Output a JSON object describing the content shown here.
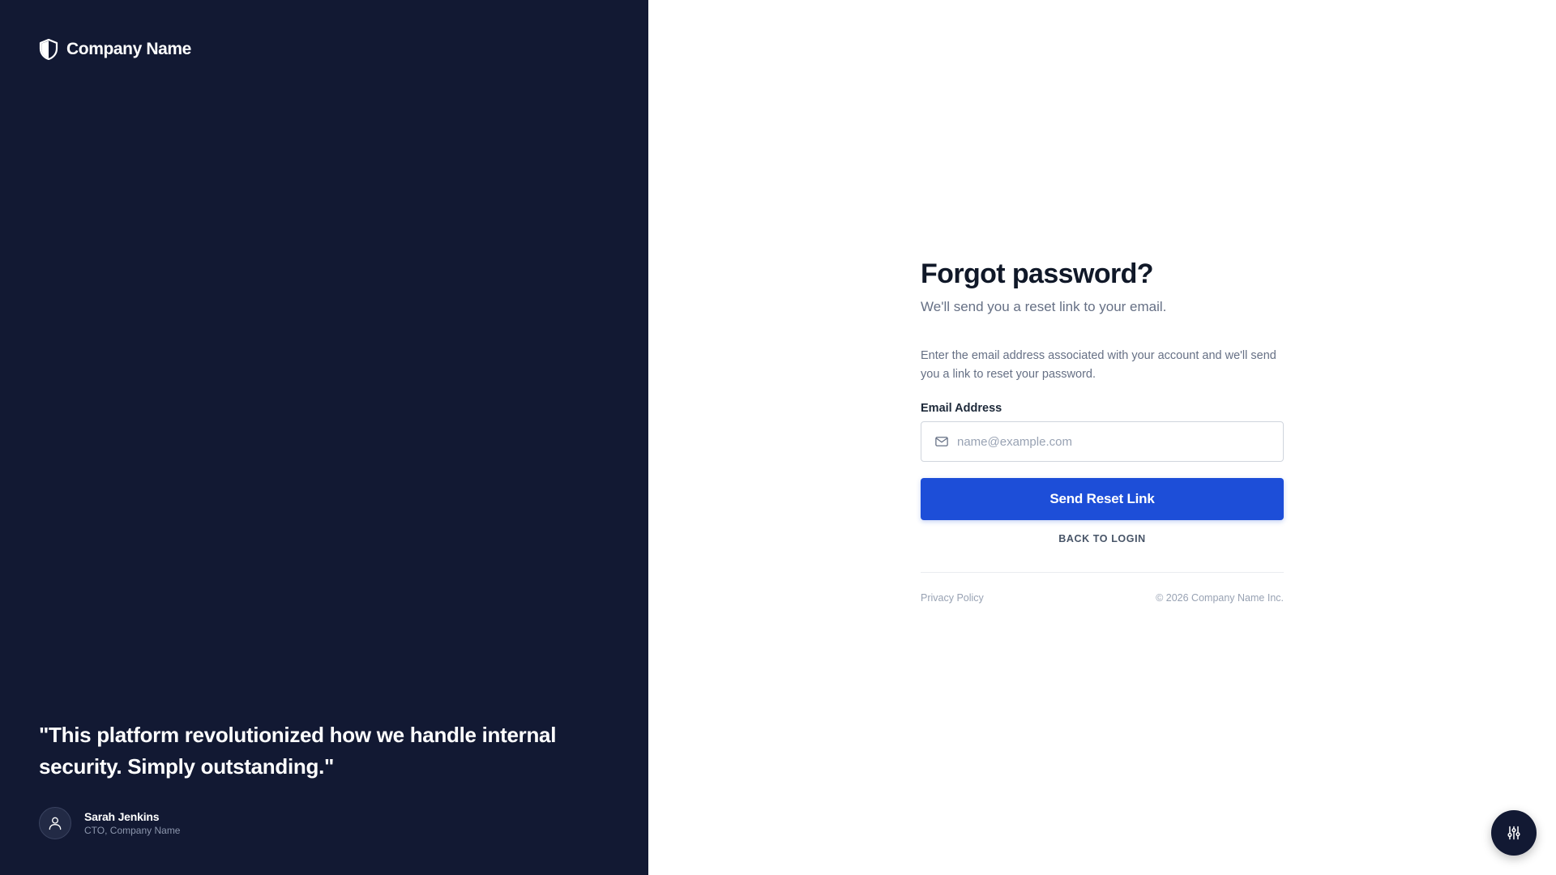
{
  "brand": {
    "name": "Company Name",
    "icon": "shield-icon"
  },
  "testimonial": {
    "quote": "\"This platform revolutionized how we handle internal security. Simply outstanding.\"",
    "author_name": "Sarah Jenkins",
    "author_role": "CTO, Company Name",
    "avatar_icon": "user-icon"
  },
  "form": {
    "title": "Forgot password?",
    "subtitle": "We'll send you a reset link to your email.",
    "description": "Enter the email address associated with your account and we'll send you a link to reset your password.",
    "email_label": "Email Address",
    "email_placeholder": "name@example.com",
    "email_value": "",
    "email_icon": "mail-icon",
    "submit_label": "Send Reset Link",
    "back_label": "BACK TO LOGIN"
  },
  "footer": {
    "privacy": "Privacy Policy",
    "copyright": "© 2026 Company Name Inc."
  },
  "fab": {
    "icon": "sliders-icon"
  },
  "colors": {
    "panel_bg": "#121933",
    "accent": "#1d4ed8",
    "heading": "#101828",
    "muted": "#667085"
  }
}
